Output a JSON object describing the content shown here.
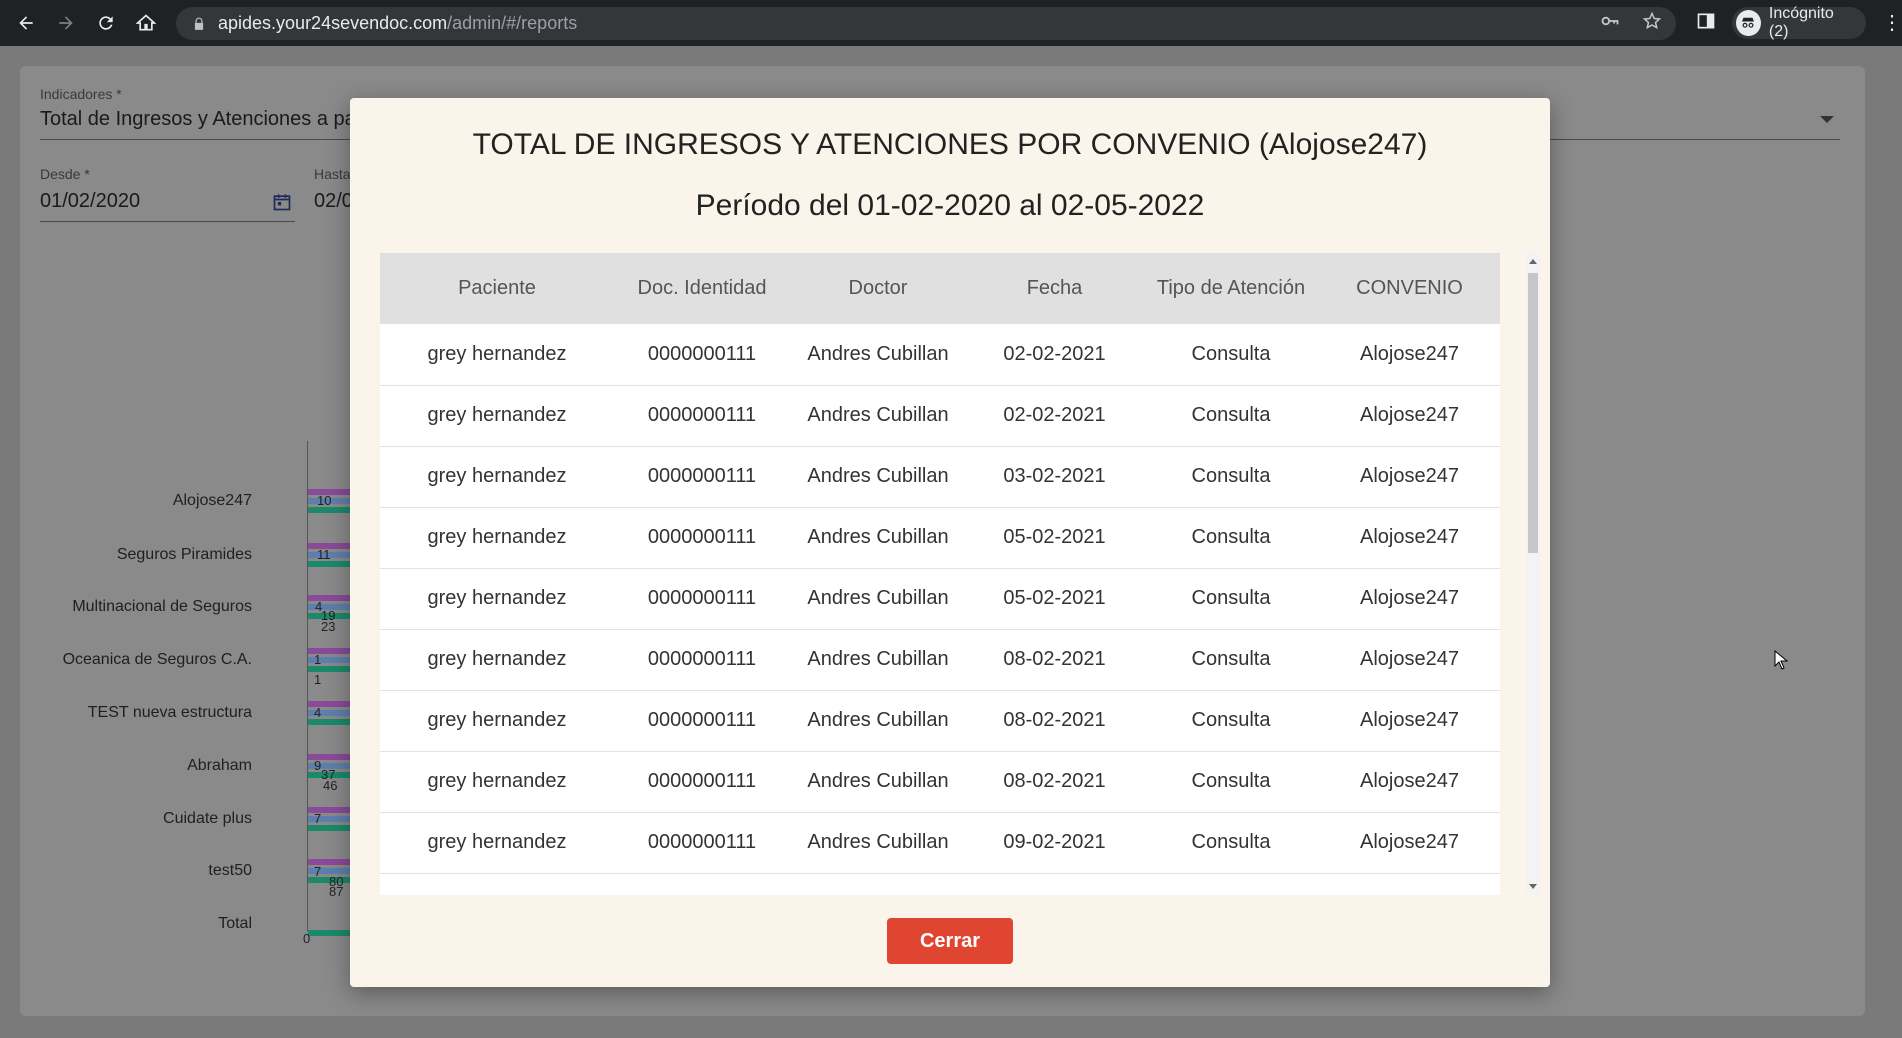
{
  "browser": {
    "url_host": "apides.your24sevendoc.com",
    "url_path": "/admin/#/reports",
    "profile_label": "Incógnito (2)"
  },
  "background": {
    "indicator_label": "Indicadores *",
    "indicator_value": "Total de Ingresos y Atenciones a pa",
    "from_label": "Desde *",
    "from_value": "01/02/2020",
    "to_label": "Hasta",
    "to_value": "02/0",
    "chart_data": {
      "type": "bar",
      "categories": [
        "Alojose247",
        "Seguros Piramides",
        "Multinacional de Seguros",
        "Oceanica de Seguros C.A.",
        "TEST nueva estructura",
        "Abraham",
        "Cuidate plus",
        "test50",
        "Total"
      ],
      "visible_value_labels": [
        "10",
        "11",
        "4",
        "19",
        "23",
        "1",
        "1",
        "4",
        "9",
        "37",
        "46",
        "7",
        "7",
        "80",
        "87"
      ],
      "x_tick_labels": [
        "0"
      ]
    }
  },
  "modal": {
    "title": "TOTAL DE INGRESOS Y ATENCIONES POR CONVENIO (Alojose247)",
    "subtitle": "Período del 01-02-2020 al 02-05-2022",
    "columns": [
      "Paciente",
      "Doc. Identidad",
      "Doctor",
      "Fecha",
      "Tipo de Atención",
      "CONVENIO"
    ],
    "rows": [
      [
        "grey hernandez",
        "0000000111",
        "Andres Cubillan",
        "02-02-2021",
        "Consulta",
        "Alojose247"
      ],
      [
        "grey hernandez",
        "0000000111",
        "Andres Cubillan",
        "02-02-2021",
        "Consulta",
        "Alojose247"
      ],
      [
        "grey hernandez",
        "0000000111",
        "Andres Cubillan",
        "03-02-2021",
        "Consulta",
        "Alojose247"
      ],
      [
        "grey hernandez",
        "0000000111",
        "Andres Cubillan",
        "05-02-2021",
        "Consulta",
        "Alojose247"
      ],
      [
        "grey hernandez",
        "0000000111",
        "Andres Cubillan",
        "05-02-2021",
        "Consulta",
        "Alojose247"
      ],
      [
        "grey hernandez",
        "0000000111",
        "Andres Cubillan",
        "08-02-2021",
        "Consulta",
        "Alojose247"
      ],
      [
        "grey hernandez",
        "0000000111",
        "Andres Cubillan",
        "08-02-2021",
        "Consulta",
        "Alojose247"
      ],
      [
        "grey hernandez",
        "0000000111",
        "Andres Cubillan",
        "08-02-2021",
        "Consulta",
        "Alojose247"
      ],
      [
        "grey hernandez",
        "0000000111",
        "Andres Cubillan",
        "09-02-2021",
        "Consulta",
        "Alojose247"
      ]
    ],
    "close_label": "Cerrar"
  }
}
